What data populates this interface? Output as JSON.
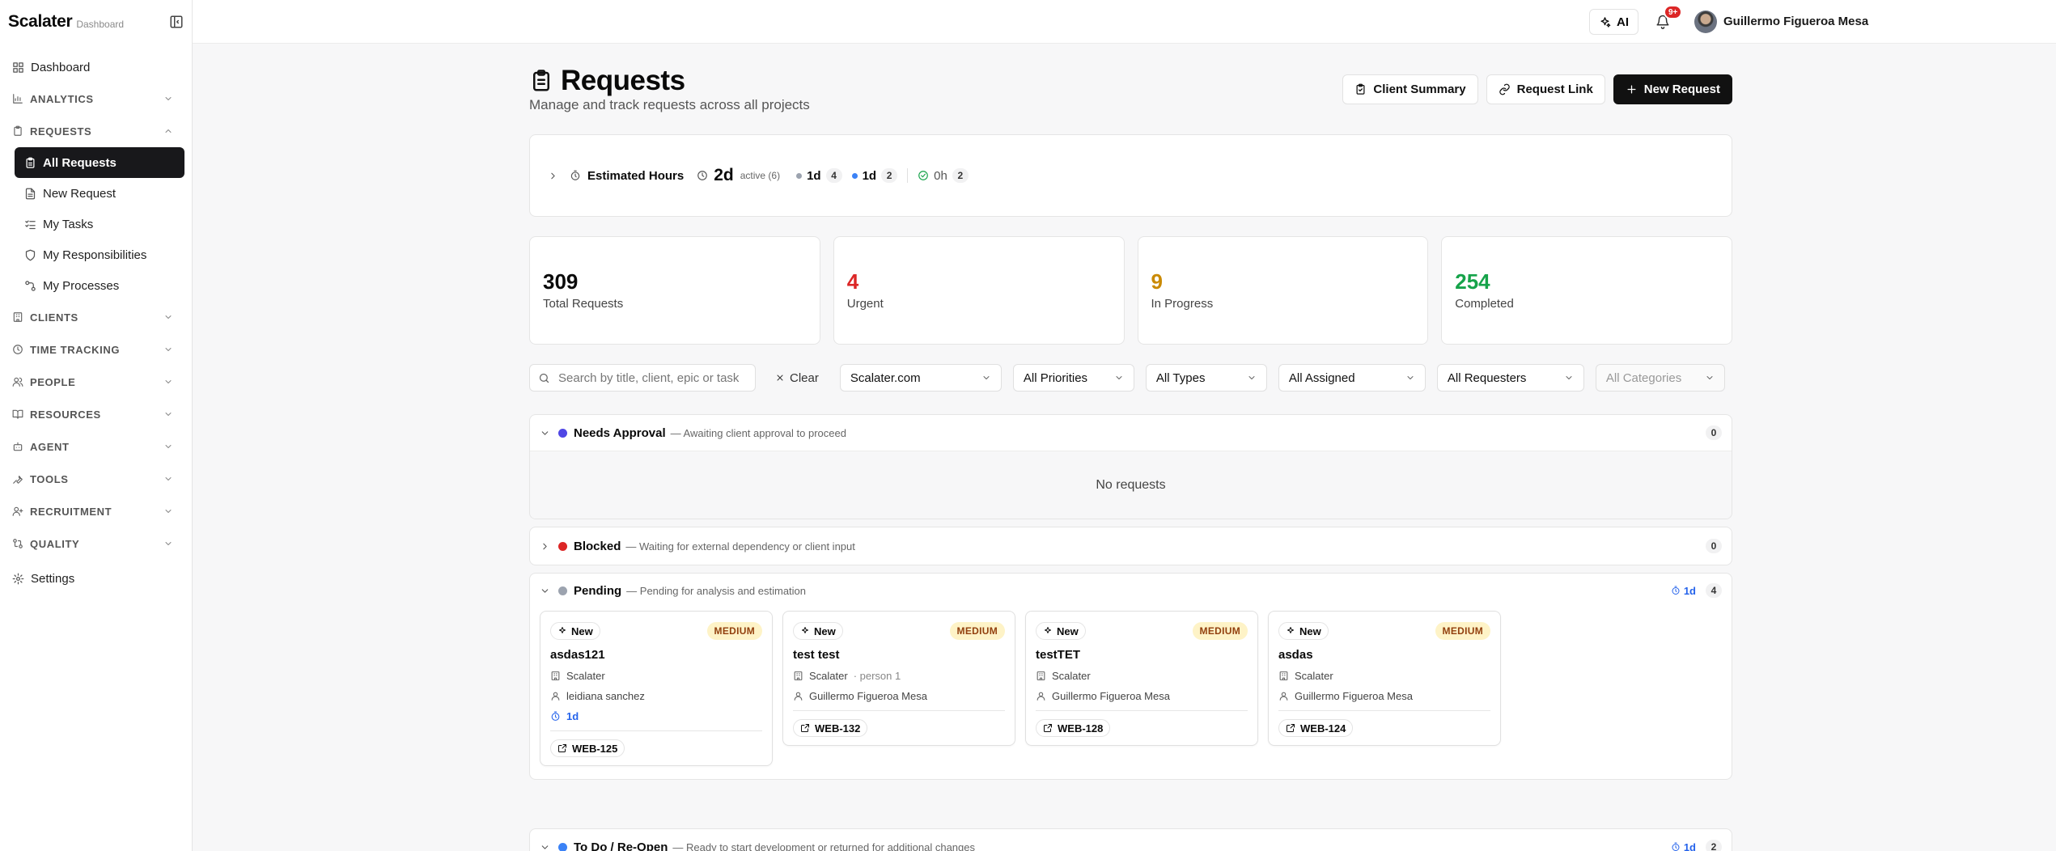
{
  "app": {
    "name": "Scalater",
    "sub": "Dashboard"
  },
  "sidebar": {
    "dashboard": "Dashboard",
    "groups": [
      {
        "label": "ANALYTICS"
      },
      {
        "label": "REQUESTS"
      },
      {
        "label": "CLIENTS"
      },
      {
        "label": "TIME TRACKING"
      },
      {
        "label": "PEOPLE"
      },
      {
        "label": "RESOURCES"
      },
      {
        "label": "AGENT"
      },
      {
        "label": "TOOLS"
      },
      {
        "label": "RECRUITMENT"
      },
      {
        "label": "QUALITY"
      }
    ],
    "requests_items": [
      "All Requests",
      "New Request",
      "My Tasks",
      "My Responsibilities",
      "My Processes"
    ],
    "settings": "Settings"
  },
  "topbar": {
    "ai_label": "AI",
    "notif_count": "9+",
    "user_name": "Guillermo Figueroa Mesa"
  },
  "page": {
    "title": "Requests",
    "subtitle": "Manage and track requests across all projects",
    "actions": {
      "client_summary": "Client Summary",
      "request_link": "Request Link",
      "new_request": "New Request"
    }
  },
  "hours": {
    "label": "Estimated Hours",
    "total": "2d",
    "active": "active (6)",
    "seg1_value": "1d",
    "seg1_count": "4",
    "seg2_value": "1d",
    "seg2_count": "2",
    "done_value": "0h",
    "done_count": "2"
  },
  "stats": [
    {
      "value": "309",
      "label": "Total Requests",
      "color": "#0a0a0a"
    },
    {
      "value": "4",
      "label": "Urgent",
      "color": "#dc2626"
    },
    {
      "value": "9",
      "label": "In Progress",
      "color": "#ca8a04"
    },
    {
      "value": "254",
      "label": "Completed",
      "color": "#16a34a"
    }
  ],
  "filters": {
    "search_placeholder": "Search by title, client, epic or task",
    "clear": "Clear",
    "client": "Scalater.com",
    "priority": "All Priorities",
    "type": "All Types",
    "assigned": "All Assigned",
    "requesters": "All Requesters",
    "categories": "All Categories"
  },
  "sections": {
    "approval": {
      "name": "Needs Approval",
      "desc": "— Awaiting client approval to proceed",
      "count": "0",
      "empty": "No requests",
      "color": "#4f46e5"
    },
    "blocked": {
      "name": "Blocked",
      "desc": "— Waiting for external dependency or client input",
      "count": "0",
      "color": "#dc2626"
    },
    "pending": {
      "name": "Pending",
      "desc": "— Pending for analysis and estimation",
      "hours": "1d",
      "count": "4",
      "color": "#9ca3af"
    },
    "todo": {
      "name": "To Do / Re-Open",
      "desc": "— Ready to start development or returned for additional changes",
      "hours": "1d",
      "count": "2",
      "color": "#3b82f6"
    }
  },
  "cards": [
    {
      "status": "New",
      "priority": "MEDIUM",
      "title": "asdas121",
      "client": "Scalater",
      "client_extra": "",
      "assignee": "leidiana sanchez",
      "hours": "1d",
      "ticket": "WEB-125"
    },
    {
      "status": "New",
      "priority": "MEDIUM",
      "title": "test test",
      "client": "Scalater",
      "client_extra": "· person 1",
      "assignee": "Guillermo Figueroa Mesa",
      "hours": "",
      "ticket": "WEB-132"
    },
    {
      "status": "New",
      "priority": "MEDIUM",
      "title": "testTET",
      "client": "Scalater",
      "client_extra": "",
      "assignee": "Guillermo Figueroa Mesa",
      "hours": "",
      "ticket": "WEB-128"
    },
    {
      "status": "New",
      "priority": "MEDIUM",
      "title": "asdas",
      "client": "Scalater",
      "client_extra": "",
      "assignee": "Guillermo Figueroa Mesa",
      "hours": "",
      "ticket": "WEB-124"
    }
  ]
}
